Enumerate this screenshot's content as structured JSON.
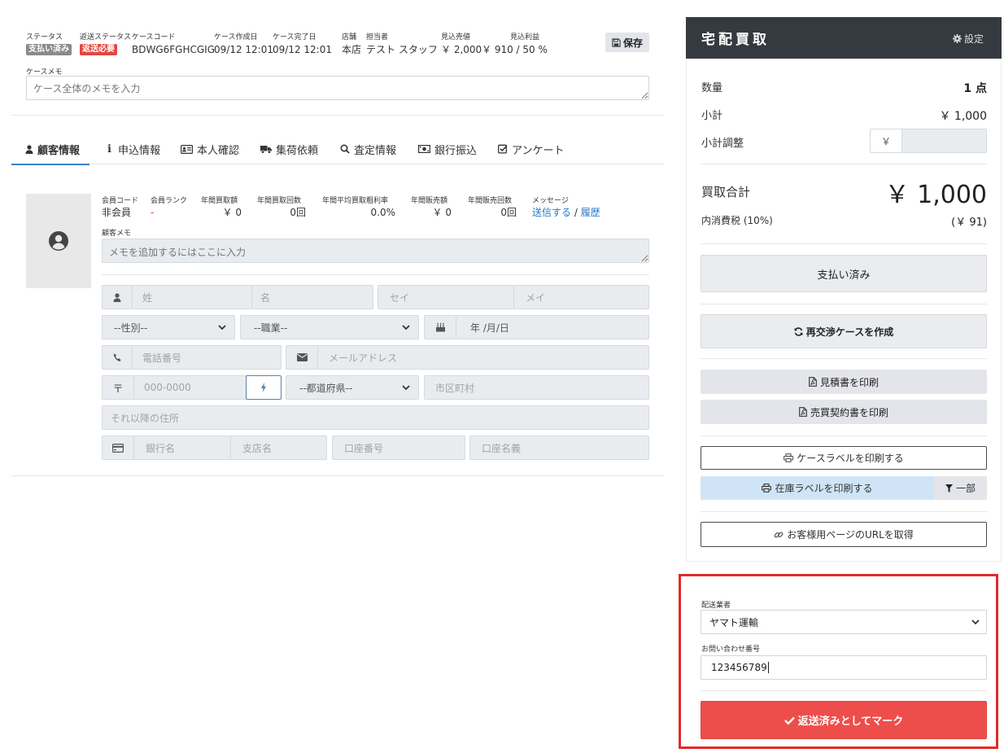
{
  "header": {
    "status_label": "ステータス",
    "status_badge": "支払い済み",
    "return_status_label": "返送ステータス",
    "return_status_badge": "返送必要",
    "case_code_label": "ケースコード",
    "case_code": "BDWG6FGHCGIG",
    "created_label": "ケース作成日",
    "created": "09/12 12:01",
    "completed_label": "ケース完了日",
    "completed": "09/12 12:01",
    "store_label": "店舗",
    "store": "本店",
    "staff_label": "担当者",
    "staff": "テスト スタッフ",
    "expected_sale_label": "見込売値",
    "expected_sale": "￥ 2,000",
    "expected_profit_label": "見込利益",
    "expected_profit": "￥ 910 / 50 %",
    "save_label": "保存",
    "memo_label": "ケースメモ",
    "memo_placeholder": "ケース全体のメモを入力"
  },
  "tabs": [
    {
      "label": "顧客情報",
      "icon": "user-icon",
      "active": true
    },
    {
      "label": "申込情報",
      "icon": "info-icon"
    },
    {
      "label": "本人確認",
      "icon": "id-card-icon"
    },
    {
      "label": "集荷依頼",
      "icon": "truck-icon"
    },
    {
      "label": "査定情報",
      "icon": "search-icon"
    },
    {
      "label": "銀行振込",
      "icon": "money-icon"
    },
    {
      "label": "アンケート",
      "icon": "check-square-icon"
    }
  ],
  "customer": {
    "member_code_label": "会員コード",
    "member_code": "非会員",
    "member_rank_label": "会員ランク",
    "member_rank": "-",
    "annual_purchase_label": "年間買取額",
    "annual_purchase": "￥ 0",
    "annual_purchase_count_label": "年間買取回数",
    "annual_purchase_count": "0回",
    "annual_margin_label": "年間平均買取粗利率",
    "annual_margin": "0.0%",
    "annual_sales_label": "年間販売額",
    "annual_sales": "￥ 0",
    "annual_sales_count_label": "年間販売回数",
    "annual_sales_count": "0回",
    "message_label": "メッセージ",
    "send_link": "送信する",
    "history_link": "履歴",
    "message_sep": "/",
    "memo_label": "顧客メモ",
    "memo_placeholder": "メモを追加するにはここに入力",
    "last_name_placeholder": "姓",
    "first_name_placeholder": "名",
    "last_name_kana_placeholder": "セイ",
    "first_name_kana_placeholder": "メイ",
    "gender_select": "--性別--",
    "job_select": "--職業--",
    "birthday_placeholder": "年 /月/日",
    "phone_placeholder": "電話番号",
    "email_placeholder": "メールアドレス",
    "postal_symbol": "〒",
    "postal_placeholder": "000-0000",
    "prefecture_select": "--都道府県--",
    "city_placeholder": "市区町村",
    "address_placeholder": "それ以降の住所",
    "bank_placeholder": "銀行名",
    "branch_placeholder": "支店名",
    "account_number_placeholder": "口座番号",
    "account_name_placeholder": "口座名義"
  },
  "panel": {
    "title": "宅配買取",
    "settings_label": "設定",
    "quantity_label": "数量",
    "quantity": "1 点",
    "subtotal_label": "小計",
    "subtotal": "￥ 1,000",
    "adjust_label": "小計調整",
    "yen_symbol": "￥",
    "total_label": "買取合計",
    "total": "￥ 1,000",
    "tax_label": "内消費税 (10%)",
    "tax": "(￥ 91)",
    "paid_button": "支払い済み",
    "renegotiate_button": "再交渉ケースを作成",
    "print_estimate_button": "見積書を印刷",
    "print_contract_button": "売買契約書を印刷",
    "print_case_label_button": "ケースラベルを印刷する",
    "print_stock_label_button": "在庫ラベルを印刷する",
    "partial_button": "一部",
    "customer_url_button": "お客様用ページのURLを取得",
    "carrier_label": "配送業者",
    "carrier_value": "ヤマト運輸",
    "tracking_label": "お問い合わせ番号",
    "tracking_value": "123456789",
    "mark_returned_button": "返送済みとしてマーク"
  },
  "colors": {
    "accent": "#3b82c4",
    "danger": "#ee4e4b",
    "header_dark": "#343a40",
    "highlight_frame": "#e02b2b"
  }
}
